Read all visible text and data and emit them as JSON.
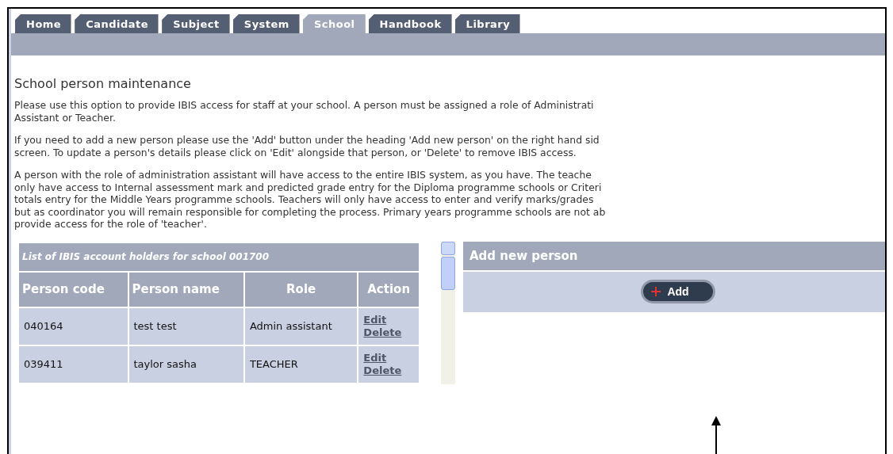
{
  "tabs": [
    {
      "label": "Home",
      "selected": false
    },
    {
      "label": "Candidate",
      "selected": false
    },
    {
      "label": "Subject",
      "selected": false
    },
    {
      "label": "System",
      "selected": false
    },
    {
      "label": "School",
      "selected": true
    },
    {
      "label": "Handbook",
      "selected": false
    },
    {
      "label": "Library",
      "selected": false
    }
  ],
  "heading": "School person maintenance",
  "paragraphs": [
    [
      "Please use this option to provide IBIS access for staff at your school. A person must be assigned a role of Administrati",
      "Assistant or Teacher."
    ],
    [
      "If you need to add a new person please use the 'Add' button under the heading 'Add new person' on the right hand sid",
      "screen. To update a person's details please click on 'Edit' alongside that person, or 'Delete' to remove IBIS access."
    ],
    [
      "A person with the role of administration assistant will have access to the entire IBIS system, as you have. The teache",
      "only have access to Internal assessment mark and predicted grade entry for the Diploma programme schools or Criteri",
      "totals entry for the Middle Years programme schools. Teachers will only have access to enter and verify marks/grades",
      "but as coordinator you will remain responsible for completing the process. Primary years programme schools are not ab",
      "provide access for the role of 'teacher'."
    ]
  ],
  "table": {
    "title": "List of IBIS account holders for school 001700",
    "columns": [
      "Person code",
      "Person name",
      "Role",
      "Action"
    ],
    "rows": [
      {
        "code": "040164",
        "name": "test test",
        "role": "Admin assistant",
        "actions": [
          "Edit",
          "Delete"
        ]
      },
      {
        "code": "039411",
        "name": "taylor sasha",
        "role": "TEACHER",
        "actions": [
          "Edit",
          "Delete"
        ]
      }
    ]
  },
  "add_panel": {
    "title": "Add new person",
    "button": "Add"
  }
}
